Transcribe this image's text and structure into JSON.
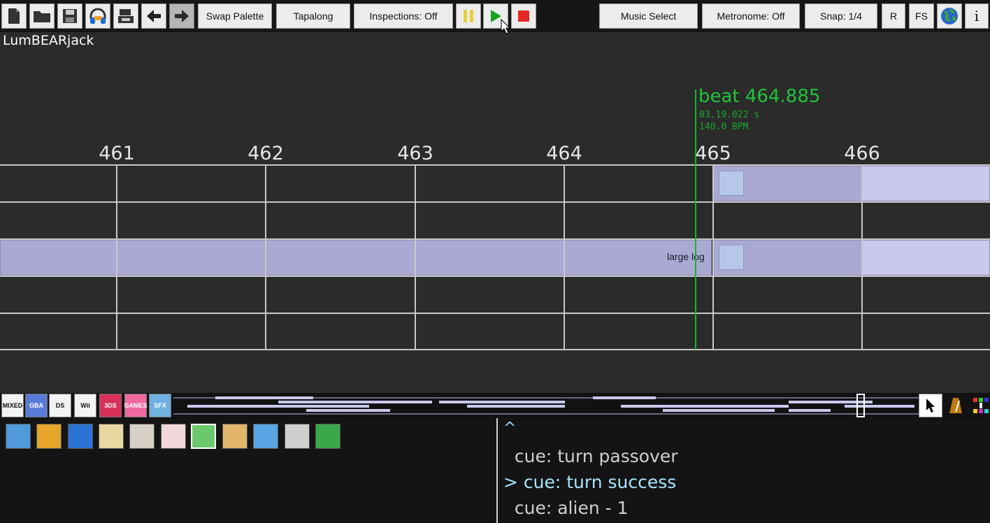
{
  "toolbar": {
    "swap_palette": "Swap Palette",
    "tapalong": "Tapalong",
    "inspections": "Inspections: Off",
    "music_select": "Music Select",
    "metronome": "Metronome: Off",
    "snap": "Snap: 1/4",
    "r": "R",
    "fs": "FS",
    "info": "i",
    "icons": [
      "new-file-icon",
      "open-folder-icon",
      "save-icon",
      "headphones-icon",
      "export-icon",
      "undo-arrow-icon",
      "redo-arrow-icon",
      "pause-icon",
      "play-icon",
      "stop-icon",
      "globe-icon"
    ]
  },
  "song": {
    "title": "LumBEARjack"
  },
  "timeline": {
    "beats": [
      "461",
      "462",
      "463",
      "464",
      "465",
      "466"
    ],
    "playhead": {
      "beat_label": "beat 464.885",
      "time_label": "03.19.022 s",
      "bpm_label": "140.0 BPM",
      "color": "#17b52a"
    },
    "events": [
      {
        "label": "large log"
      }
    ],
    "block_color": "#a9a9d4"
  },
  "game_strip": {
    "consoles": [
      "MIXED",
      "GBA",
      "DS",
      "Wii",
      "3DS",
      "GAMES",
      "SFX"
    ]
  },
  "palette": {
    "games": [
      "bear-game-icon",
      "pineapple-game-icon",
      "blue-blob-game-icon",
      "cat-game-icon",
      "lumberjack-game-icon",
      "pillow-game-icon",
      "speech-bubble-game-icon",
      "twins-game-icon",
      "scientist-game-icon",
      "robot-game-icon",
      "chameleon-game-icon"
    ],
    "selected_index": 6
  },
  "cue_list": {
    "caret": "^",
    "items": [
      {
        "text": "  cue: turn passover",
        "selected": false
      },
      {
        "text": "> cue: turn success",
        "selected": true
      },
      {
        "text": "  cue: alien - 1",
        "selected": false
      }
    ]
  }
}
